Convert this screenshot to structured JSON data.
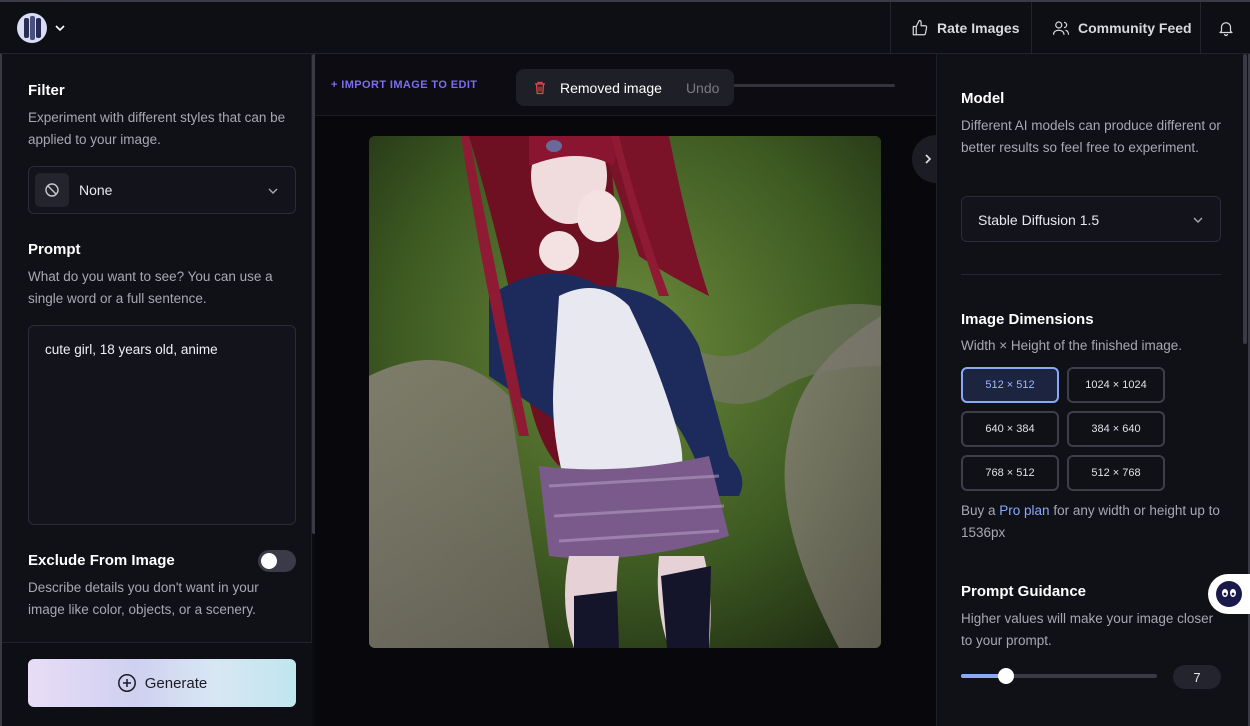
{
  "topbar": {
    "rate_images": "Rate Images",
    "community_feed": "Community Feed"
  },
  "left": {
    "filter": {
      "title": "Filter",
      "description": "Experiment with different styles that can be applied to your image.",
      "selected": "None"
    },
    "prompt": {
      "title": "Prompt",
      "description": "What do you want to see? You can use a single word or a full sentence.",
      "value": "cute girl, 18 years old, anime"
    },
    "exclude": {
      "title": "Exclude From Image",
      "description": "Describe details you don't want in your image like color, objects, or a scenery.",
      "enabled": false
    },
    "generate_label": "Generate"
  },
  "center": {
    "import_label": "+ IMPORT IMAGE TO EDIT",
    "toast": {
      "message": "Removed image",
      "undo": "Undo"
    }
  },
  "right": {
    "model": {
      "title": "Model",
      "description": "Different AI models can produce different or better results so feel free to experiment.",
      "selected": "Stable Diffusion 1.5"
    },
    "dimensions": {
      "title": "Image Dimensions",
      "description": "Width × Height of the finished image.",
      "options": [
        "512 × 512",
        "1024 × 1024",
        "640 × 384",
        "384 × 640",
        "768 × 512",
        "512 × 768"
      ],
      "selected": "512 × 512",
      "pro_prefix": "Buy a ",
      "pro_link": "Pro plan",
      "pro_suffix": " for any width or height up to 1536px"
    },
    "guidance": {
      "title": "Prompt Guidance",
      "description": "Higher values will make your image closer to your prompt.",
      "value": "7",
      "fraction": 0.23
    }
  },
  "colors": {
    "accent": "#8aa8f6",
    "import_link": "#7d6ef0",
    "panel_bg": "#101017",
    "canvas_bg": "#07070c"
  }
}
